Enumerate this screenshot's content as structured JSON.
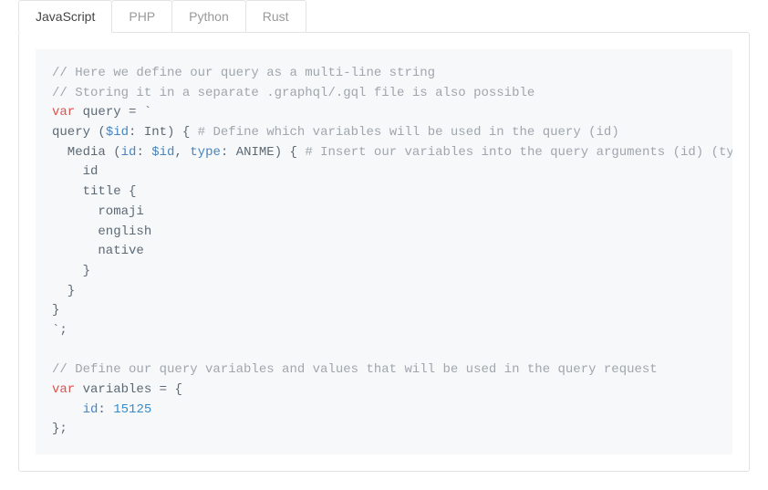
{
  "tabs": [
    {
      "label": "JavaScript",
      "active": true
    },
    {
      "label": "PHP",
      "active": false
    },
    {
      "label": "Python",
      "active": false
    },
    {
      "label": "Rust",
      "active": false
    }
  ],
  "code": {
    "c1": "// Here we define our query as a multi-line string",
    "c2": "// Storing it in a separate .graphql/.gql file is also possible",
    "kw_var": "var",
    "ident_query": "query",
    "eq_tick": " = `",
    "q_line": "query (",
    "q_dollar_id": "$id",
    "q_int": ": Int) { ",
    "q_comment1": "# Define which variables will be used in the query (id)",
    "media_line1": "  Media (",
    "media_id_attr": "id",
    "media_colon": ": ",
    "media_dollar_id": "$id",
    "media_type": ", ",
    "media_type_attr": "type",
    "media_anime": ": ANIME) { ",
    "media_comment": "# Insert our variables into the query arguments (id) (type",
    "field_id": "    id",
    "field_title": "    title {",
    "field_romaji": "      romaji",
    "field_english": "      english",
    "field_native": "      native",
    "close_title": "    }",
    "close_media": "  }",
    "close_query": "}",
    "end_tick": "`;",
    "c3": "// Define our query variables and values that will be used in the query request",
    "ident_variables": "variables",
    "obj_open": " = {",
    "var_id_attr": "id",
    "var_id_colon": ": ",
    "var_id_val": "15125",
    "obj_close": "};"
  }
}
